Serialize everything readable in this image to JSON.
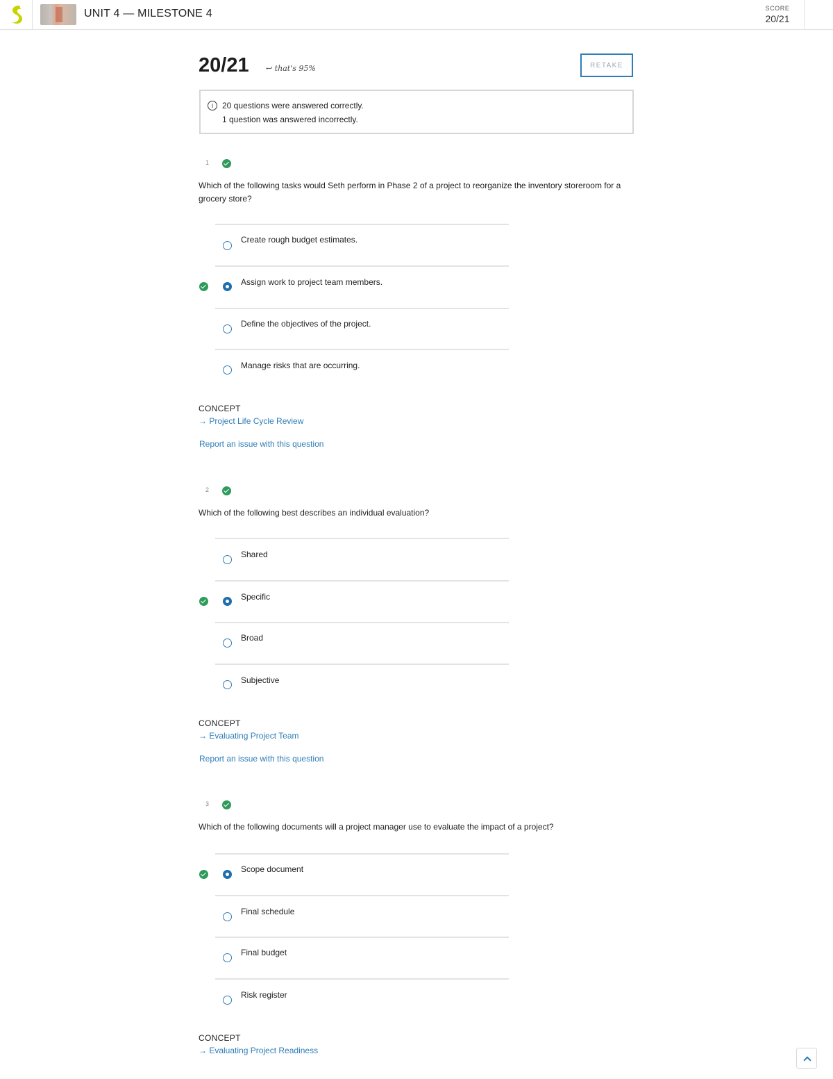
{
  "header": {
    "logo_icon": "sophia-logo-icon",
    "title": "UNIT 4 — MILESTONE 4",
    "score_label": "SCORE",
    "score_value": "20/21",
    "brand_color": "#c8d400"
  },
  "result": {
    "score": "20/21",
    "percent_note": "that's 95%",
    "retake_label": "RETAKE",
    "summary_correct": "20 questions were answered correctly.",
    "summary_incorrect": "1 question was answered incorrectly."
  },
  "questions": [
    {
      "number": "1",
      "status": "correct",
      "text": "Which of the following tasks would Seth perform in Phase 2 of a project to reorganize the inventory storeroom for a grocery store?",
      "answers": [
        {
          "label": "Create rough budget estimates.",
          "selected": false,
          "correct": false
        },
        {
          "label": "Assign work to project team members.",
          "selected": true,
          "correct": true
        },
        {
          "label": "Define the objectives of the project.",
          "selected": false,
          "correct": false
        },
        {
          "label": "Manage risks that are occurring.",
          "selected": false,
          "correct": false
        }
      ],
      "concept_label": "CONCEPT",
      "concept_link": "→ Project Life Cycle Review",
      "report_link": "Report an issue with this question"
    },
    {
      "number": "2",
      "status": "correct",
      "text": "Which of the following best describes an individual evaluation?",
      "answers": [
        {
          "label": "Shared",
          "selected": false,
          "correct": false
        },
        {
          "label": "Specific",
          "selected": true,
          "correct": true
        },
        {
          "label": "Broad",
          "selected": false,
          "correct": false
        },
        {
          "label": "Subjective",
          "selected": false,
          "correct": false
        }
      ],
      "concept_label": "CONCEPT",
      "concept_link": "→ Evaluating Project Team",
      "report_link": "Report an issue with this question"
    },
    {
      "number": "3",
      "status": "correct",
      "text": "Which of the following documents will a project manager use to evaluate the impact of a project?",
      "answers": [
        {
          "label": "Scope document",
          "selected": true,
          "correct": true
        },
        {
          "label": "Final schedule",
          "selected": false,
          "correct": false
        },
        {
          "label": "Final budget",
          "selected": false,
          "correct": false
        },
        {
          "label": "Risk register",
          "selected": false,
          "correct": false
        }
      ],
      "concept_label": "CONCEPT",
      "concept_link": "→ Evaluating Project Readiness"
    }
  ],
  "colors": {
    "accent": "#2e7db8",
    "correct": "#2e9a5b"
  }
}
